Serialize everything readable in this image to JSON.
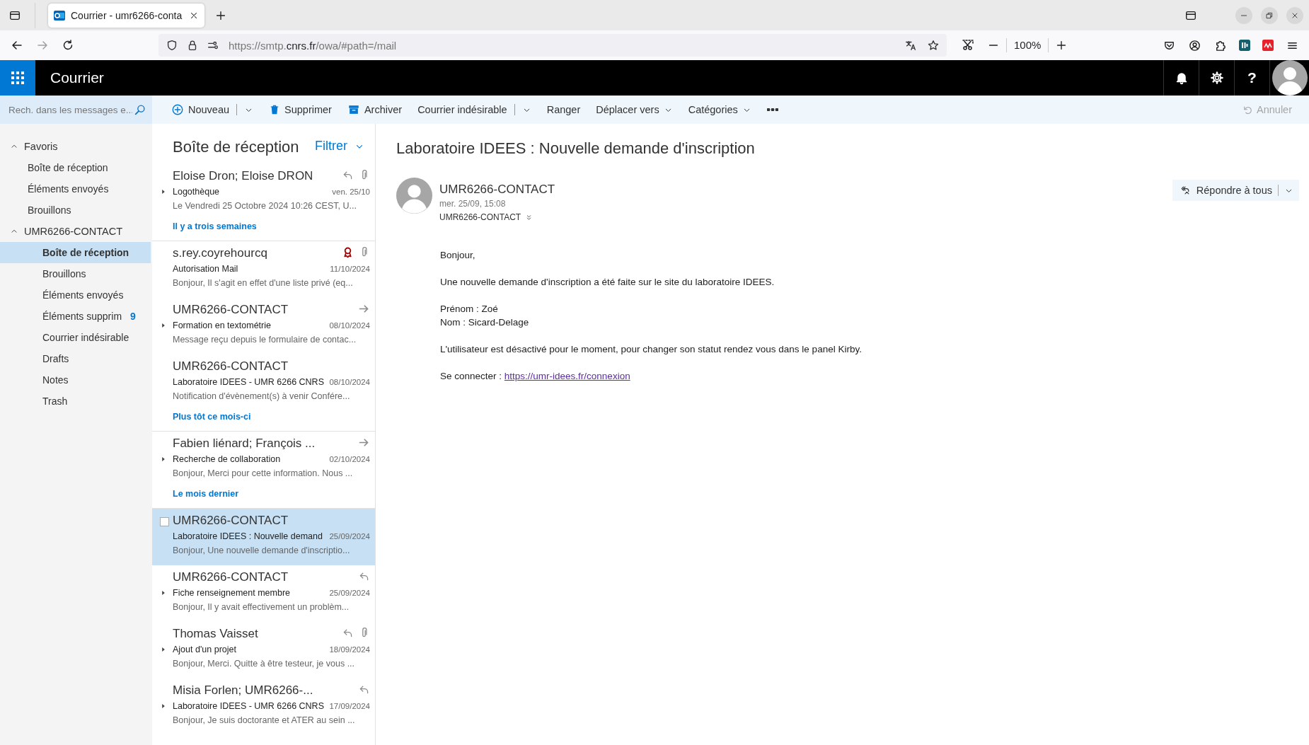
{
  "browser": {
    "tab": {
      "title": "Courrier - umr6266-conta",
      "selected": true
    },
    "forward_disabled": true,
    "url": "https://smtp.**cnrs.fr**/owa/#path=/mail",
    "zoom": "100%"
  },
  "app": {
    "title": "Courrier",
    "help": "?"
  },
  "search": {
    "placeholder": "Rech. dans les messages e..."
  },
  "commands": [
    {
      "kind": "new",
      "label": "Nouveau",
      "split": true,
      "dropdown": true
    },
    {
      "kind": "delete",
      "label": "Supprimer",
      "split": false,
      "dropdown": false
    },
    {
      "kind": "archive",
      "label": "Archiver",
      "split": false,
      "dropdown": false
    },
    {
      "kind": "text",
      "label": "Courrier indésirable",
      "split": true,
      "dropdown": true
    },
    {
      "kind": "text",
      "label": "Ranger",
      "split": false,
      "dropdown": false
    },
    {
      "kind": "text",
      "label": "Déplacer vers",
      "split": false,
      "dropdown": true
    },
    {
      "kind": "text",
      "label": "Catégories",
      "split": false,
      "dropdown": true
    },
    {
      "kind": "more"
    }
  ],
  "undo": {
    "label": "Annuler",
    "disabled": true
  },
  "folders": [
    {
      "label": "Favoris",
      "expanded": true,
      "selected": false,
      "children": [
        {
          "label": "Boîte de réception",
          "selected": false
        },
        {
          "label": "Éléments envoyés",
          "selected": false
        },
        {
          "label": "Brouillons",
          "selected": false
        }
      ]
    },
    {
      "label": "UMR6266-CONTACT",
      "expanded": true,
      "selected": false,
      "children": [
        {
          "label": "Boîte de réception",
          "selected": true
        },
        {
          "label": "Brouillons",
          "selected": false
        },
        {
          "label": "Éléments envoyés",
          "selected": false
        },
        {
          "label": "Éléments supprim",
          "count": "9",
          "selected": false
        },
        {
          "label": "Courrier indésirable",
          "selected": false
        },
        {
          "label": "Drafts",
          "selected": false
        },
        {
          "label": "Notes",
          "selected": false
        },
        {
          "label": "Trash",
          "selected": false
        }
      ]
    }
  ],
  "message_list": {
    "title": "Boîte de réception",
    "filter": "Filtrer",
    "items": [
      {
        "kind": "message",
        "sender": "Eloise Dron; Eloise DRON",
        "subject": "Logothèque",
        "date": "ven. 25/10",
        "preview": "Le Vendredi 25 Octobre 2024 10:26 CEST, U...",
        "selected": false,
        "expandable": true,
        "replied": true,
        "forwarded": false,
        "attachment": true,
        "flagged": false
      },
      {
        "kind": "group",
        "label": "Il y a trois semaines"
      },
      {
        "kind": "message",
        "sender": "s.rey.coyrehourcq",
        "subject": "Autorisation Mail",
        "date": "11/10/2024",
        "preview": "Bonjour,  Il s'agit en effet d'une liste privé (eq...",
        "selected": false,
        "expandable": false,
        "replied": false,
        "forwarded": false,
        "attachment": true,
        "flagged": true
      },
      {
        "kind": "message",
        "sender": "UMR6266-CONTACT",
        "subject": "Formation en textométrie",
        "date": "08/10/2024",
        "preview": "Message reçu depuis le formulaire de contac...",
        "selected": false,
        "expandable": true,
        "replied": false,
        "forwarded": true,
        "attachment": false,
        "flagged": false
      },
      {
        "kind": "message",
        "sender": "UMR6266-CONTACT",
        "subject": "Laboratoire IDEES - UMR 6266 CNRS",
        "date": "08/10/2024",
        "preview": "Notification d'évènement(s) à venir  Confére...",
        "selected": false,
        "expandable": false,
        "replied": false,
        "forwarded": false,
        "attachment": false,
        "flagged": false
      },
      {
        "kind": "group",
        "label": "Plus tôt ce mois-ci"
      },
      {
        "kind": "message",
        "sender": "Fabien liénard; François ...",
        "subject": "Recherche de collaboration",
        "date": "02/10/2024",
        "preview": "Bonjour, Merci pour cette information. Nous ...",
        "selected": false,
        "expandable": true,
        "replied": false,
        "forwarded": true,
        "attachment": false,
        "flagged": false
      },
      {
        "kind": "group",
        "label": "Le mois dernier"
      },
      {
        "kind": "message",
        "sender": "UMR6266-CONTACT",
        "subject": "Laboratoire IDEES : Nouvelle demand",
        "date": "25/09/2024",
        "preview": "Bonjour,  Une nouvelle demande d'inscriptio...",
        "selected": true,
        "expandable": false,
        "replied": false,
        "forwarded": false,
        "attachment": false,
        "flagged": false
      },
      {
        "kind": "message",
        "sender": "UMR6266-CONTACT",
        "subject": "Fiche renseignement membre",
        "date": "25/09/2024",
        "preview": "Bonjour,  Il y avait effectivement un problèm...",
        "selected": false,
        "expandable": true,
        "replied": true,
        "forwarded": false,
        "attachment": false,
        "flagged": false
      },
      {
        "kind": "message",
        "sender": "Thomas Vaisset",
        "subject": "Ajout d'un projet",
        "date": "18/09/2024",
        "preview": "Bonjour,  Merci. Quitte à être testeur, je vous ...",
        "selected": false,
        "expandable": true,
        "replied": true,
        "forwarded": false,
        "attachment": true,
        "flagged": false
      },
      {
        "kind": "message",
        "sender": "Misia Forlen; UMR6266-...",
        "subject": "Laboratoire IDEES - UMR 6266 CNRS",
        "date": "17/09/2024",
        "preview": "Bonjour,  Je suis doctorante et ATER au sein ...",
        "selected": false,
        "expandable": true,
        "replied": true,
        "forwarded": false,
        "attachment": false,
        "flagged": false
      }
    ]
  },
  "reading": {
    "subject": "Laboratoire IDEES : Nouvelle demande d'inscription",
    "sender": "UMR6266-CONTACT",
    "date": "mer. 25/09, 15:08",
    "to": "UMR6266-CONTACT",
    "reply_all": "Répondre à tous",
    "body": [
      {
        "lines": [
          "Bonjour,"
        ]
      },
      {
        "lines": [
          "Une nouvelle demande d'inscription a été faite sur le site du laboratoire IDEES."
        ]
      },
      {
        "lines": [
          "Prénom : Zoé",
          "Nom : Sicard-Delage"
        ]
      },
      {
        "lines": [
          "L'utilisateur est désactivé pour le moment, pour changer son statut rendez vous dans le panel Kirby."
        ]
      },
      {
        "lines": [
          "Se connecter : "
        ],
        "link": "https://umr-idees.fr/connexion"
      }
    ]
  }
}
